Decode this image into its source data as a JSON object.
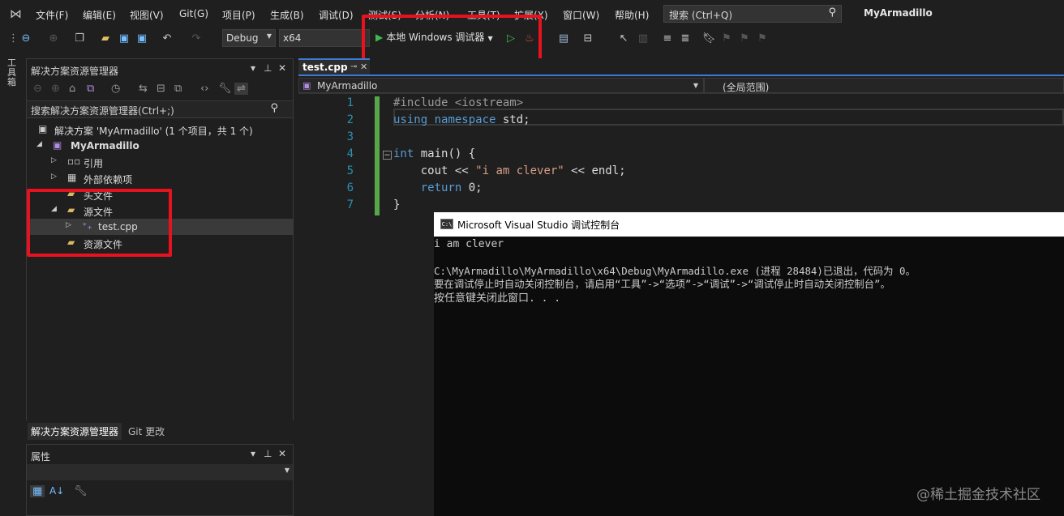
{
  "menu": {
    "items": [
      "文件(F)",
      "编辑(E)",
      "视图(V)",
      "Git(G)",
      "项目(P)",
      "生成(B)",
      "调试(D)",
      "测试(S)",
      "分析(N)",
      "工具(T)",
      "扩展(X)",
      "窗口(W)",
      "帮助(H)"
    ],
    "search_placeholder": "搜索 (Ctrl+Q)",
    "app_title": "MyArmadillo"
  },
  "toolbar": {
    "config": "Debug",
    "platform": "x64",
    "run_label": "本地 Windows 调试器"
  },
  "left_strip": {
    "toolbox_label": "工具箱"
  },
  "solution_explorer": {
    "title": "解决方案资源管理器",
    "search_placeholder": "搜索解决方案资源管理器(Ctrl+;)",
    "solution_label": "解决方案 'MyArmadillo' (1 个项目，共 1 个)",
    "project": "MyArmadillo",
    "nodes": [
      "引用",
      "外部依赖项",
      "头文件",
      "源文件",
      "test.cpp",
      "资源文件"
    ]
  },
  "bottom_tabs": [
    "解决方案资源管理器",
    "Git 更改"
  ],
  "properties": {
    "title": "属性"
  },
  "editor": {
    "tab": "test.cpp",
    "nav_project": "MyArmadillo",
    "nav_scope": "(全局范围)",
    "line_numbers": [
      "1",
      "2",
      "3",
      "4",
      "5",
      "6",
      "7"
    ],
    "code": {
      "l1_pp": "#include",
      "l1_rest": " <iostream>",
      "l2_kw1": "using",
      "l2_kw2": "namespace",
      "l2_rest": " std;",
      "l4_kw": "int",
      "l4_rest": " main() {",
      "l5_a": "    cout << ",
      "l5_str": "\"i am clever\"",
      "l5_b": " << endl;",
      "l6_kw": "    return",
      "l6_rest": " 0;",
      "l7": "}"
    }
  },
  "console": {
    "title": "Microsoft Visual Studio 调试控制台",
    "icon_text": "C:\\",
    "lines": [
      "i am clever",
      "",
      "C:\\MyArmadillo\\MyArmadillo\\x64\\Debug\\MyArmadillo.exe (进程 28484)已退出，代码为 0。",
      "要在调试停止时自动关闭控制台，请启用“工具”->“选项”->“调试”->“调试停止时自动关闭控制台”。",
      "按任意键关闭此窗口. . ."
    ]
  },
  "watermark": "@稀土掘金技术社区",
  "colors": {
    "highlight_red": "#e8121f",
    "accent_blue": "#3c7bd5",
    "modified_green": "#57a64a"
  }
}
